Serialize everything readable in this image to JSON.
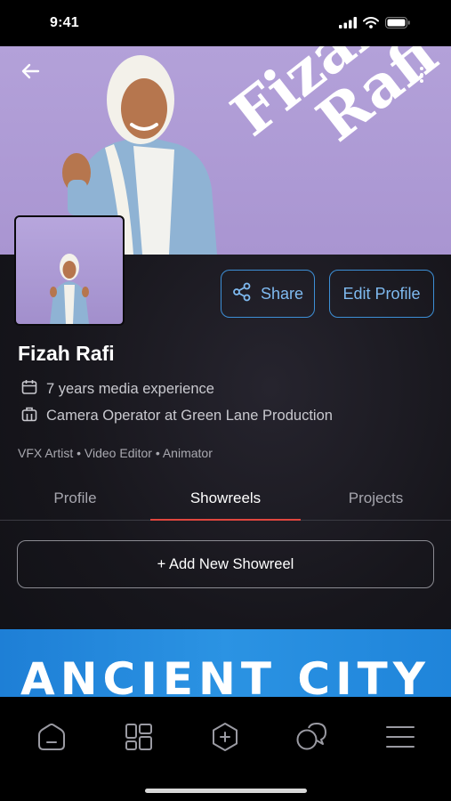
{
  "status_bar": {
    "time": "9:41"
  },
  "banner": {
    "name_line1": "Fizah",
    "name_line2": "Rafi"
  },
  "actions": {
    "share": "Share",
    "edit_profile": "Edit Profile"
  },
  "profile": {
    "name": "Fizah Rafi",
    "experience": "7 years media experience",
    "job": "Camera Operator at Green Lane Production",
    "skills": "VFX Artist • Video Editor • Animator"
  },
  "tabs": [
    {
      "label": "Profile",
      "active": false
    },
    {
      "label": "Showreels",
      "active": true
    },
    {
      "label": "Projects",
      "active": false
    }
  ],
  "showreels": {
    "add_label": "+ Add New Showreel",
    "first_title": "ANCIENT CITY"
  },
  "colors": {
    "accent_blue": "#3d8fd6",
    "tab_indicator": "#e0463e",
    "banner_bg": "#b3a1d9",
    "card_blue": "#2b93e3"
  },
  "bottom_nav": [
    "home-icon",
    "dashboard-icon",
    "add-icon",
    "chat-icon",
    "menu-icon"
  ]
}
